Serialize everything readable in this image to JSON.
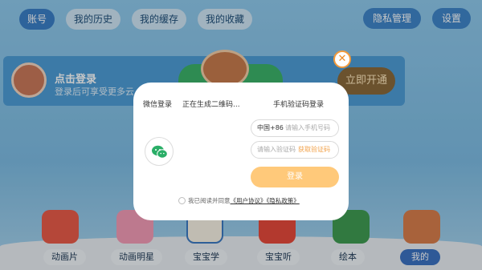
{
  "tabs": [
    {
      "label": "账号",
      "active": true
    },
    {
      "label": "我的历史",
      "active": false
    },
    {
      "label": "我的缓存",
      "active": false
    },
    {
      "label": "我的收藏",
      "active": false
    }
  ],
  "top_right": {
    "privacy": "隐私管理",
    "settings": "设置"
  },
  "banner": {
    "title": "点击登录",
    "subtitle": "登录后可享受更多云",
    "vip_button": "立即开通"
  },
  "bottom_nav": [
    {
      "label": "动画片",
      "active": false
    },
    {
      "label": "动画明星",
      "active": false
    },
    {
      "label": "宝宝学",
      "active": false
    },
    {
      "label": "宝宝听",
      "active": false
    },
    {
      "label": "绘本",
      "active": false
    },
    {
      "label": "我的",
      "active": true
    }
  ],
  "modal": {
    "close_glyph": "✕",
    "wechat_title": "微信登录",
    "qr_status": "正在生成二维码...",
    "phone_title": "手机验证码登录",
    "country_code": "中国+86",
    "phone_placeholder": "请输入手机号码",
    "code_placeholder": "请输入验证码",
    "get_code": "获取验证码",
    "login_button": "登录",
    "agree_prefix": "我已阅读并同意",
    "user_agreement": "《用户协议》",
    "privacy_policy": "《隐私政策》"
  },
  "colors": {
    "accent_orange": "#f08a23",
    "login_button": "#ffc97a",
    "wechat_green": "#2aae67",
    "tab_active": "#3a7fc7"
  },
  "icons": [
    "wechat-icon",
    "close-icon"
  ]
}
